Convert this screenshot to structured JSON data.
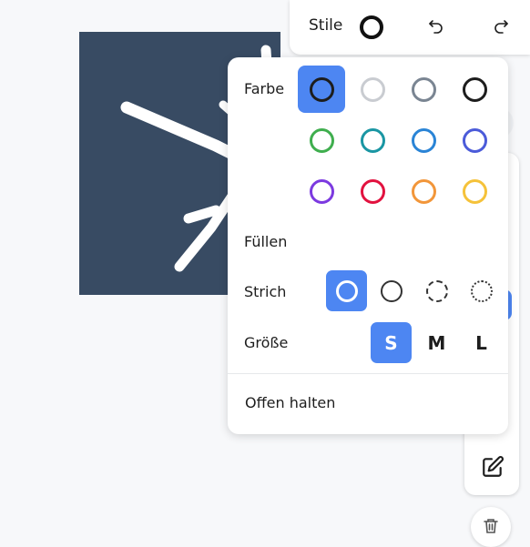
{
  "topbar": {
    "stile_label": "Stile",
    "undo_icon": "undo-icon",
    "redo_icon": "redo-icon"
  },
  "panel": {
    "farbe_label": "Farbe",
    "fuellen_label": "Füllen",
    "strich_label": "Strich",
    "groesse_label": "Größe",
    "keep_open_label": "Offen halten",
    "colors": [
      {
        "name": "black",
        "hex": "#1d1d1d",
        "selected": true
      },
      {
        "name": "light-gray",
        "hex": "#c9ccd1",
        "selected": false
      },
      {
        "name": "gray",
        "hex": "#7a8592",
        "selected": false
      },
      {
        "name": "black-2",
        "hex": "#1d1d1d",
        "selected": false
      },
      {
        "name": "green",
        "hex": "#3fae4e",
        "selected": false
      },
      {
        "name": "teal",
        "hex": "#1a96a3",
        "selected": false
      },
      {
        "name": "blue",
        "hex": "#2a84d6",
        "selected": false
      },
      {
        "name": "indigo",
        "hex": "#4b5bd9",
        "selected": false
      },
      {
        "name": "violet",
        "hex": "#7c3ae0",
        "selected": false
      },
      {
        "name": "red",
        "hex": "#e2123f",
        "selected": false
      },
      {
        "name": "orange",
        "hex": "#f2963a",
        "selected": false
      },
      {
        "name": "yellow",
        "hex": "#f5c23a",
        "selected": false
      }
    ],
    "strokes": [
      {
        "name": "solid-draw",
        "selected": true
      },
      {
        "name": "solid",
        "selected": false
      },
      {
        "name": "dashed",
        "selected": false
      },
      {
        "name": "dotted",
        "selected": false
      }
    ],
    "sizes": [
      {
        "label": "S",
        "selected": true
      },
      {
        "label": "M",
        "selected": false
      },
      {
        "label": "L",
        "selected": false
      }
    ]
  },
  "accent": "#4d86f2"
}
